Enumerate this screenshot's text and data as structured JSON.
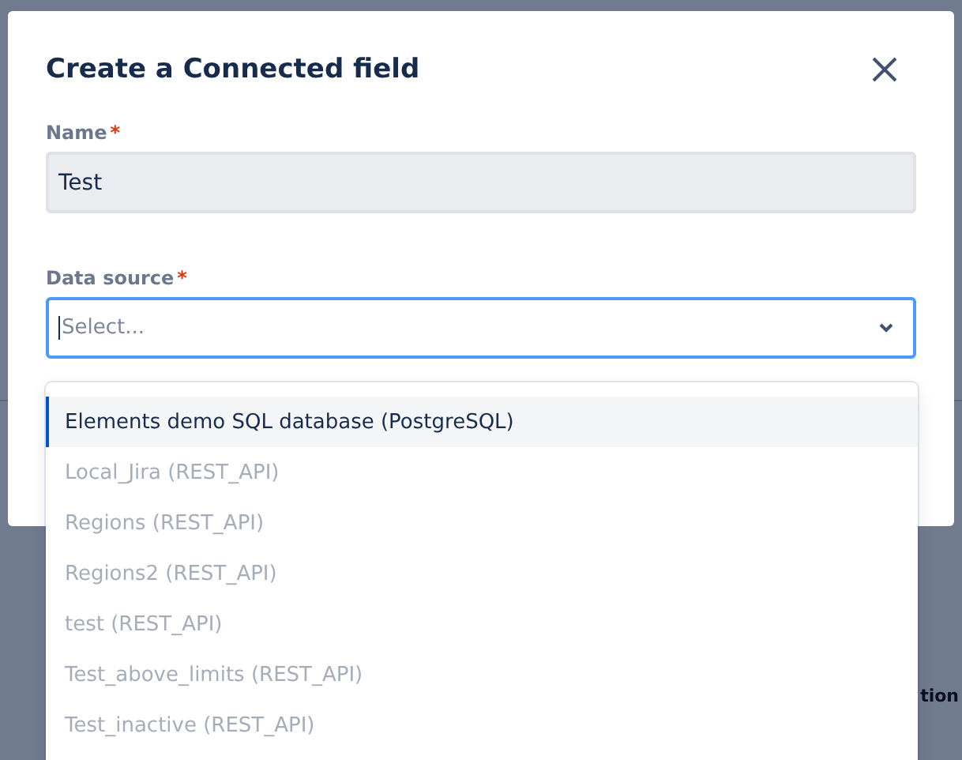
{
  "background_fragments": [
    {
      "text": "tion"
    }
  ],
  "dialog": {
    "title": "Create a Connected field",
    "fields": [
      {
        "label": "Name",
        "required_mark": "*",
        "value": "Test"
      }
    ],
    "select": {
      "label": "Data source",
      "required_mark": "*",
      "placeholder": "Select...",
      "focused": true
    },
    "options": [
      {
        "label": "Elements demo SQL database (PostgreSQL)",
        "selected": true,
        "disabled": false
      },
      {
        "label": "Local_Jira (REST_API)",
        "selected": false,
        "disabled": true
      },
      {
        "label": "Regions (REST_API)",
        "selected": false,
        "disabled": true
      },
      {
        "label": "Regions2 (REST_API)",
        "selected": false,
        "disabled": true
      },
      {
        "label": "test (REST_API)",
        "selected": false,
        "disabled": true
      },
      {
        "label": "Test_above_limits (REST_API)",
        "selected": false,
        "disabled": true
      },
      {
        "label": "Test_inactive (REST_API)",
        "selected": false,
        "disabled": true
      }
    ]
  }
}
